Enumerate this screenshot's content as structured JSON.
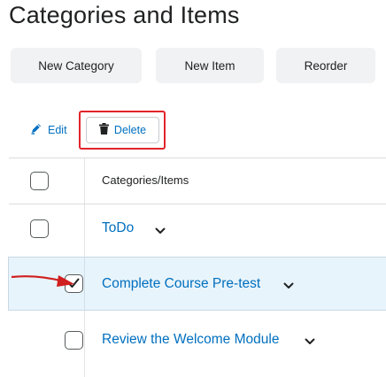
{
  "page": {
    "title": "Categories and Items"
  },
  "toolbar": {
    "new_category_label": "New Category",
    "new_item_label": "New Item",
    "reorder_label": "Reorder"
  },
  "actions": {
    "edit_label": "Edit",
    "edit_icon": "pencil-icon",
    "delete_label": "Delete",
    "delete_icon": "trash-icon"
  },
  "table": {
    "header_label": "Categories/Items",
    "rows": [
      {
        "label": "ToDo",
        "type": "category",
        "checked": false
      },
      {
        "label": "Complete Course Pre-test",
        "type": "item",
        "checked": true,
        "selected": true
      },
      {
        "label": "Review the Welcome Module",
        "type": "item",
        "checked": false
      }
    ]
  },
  "colors": {
    "accent": "#006fbf",
    "highlight": "#e2242a",
    "selected_row": "#e8f4fb",
    "button_bg": "#f1f2f3"
  }
}
